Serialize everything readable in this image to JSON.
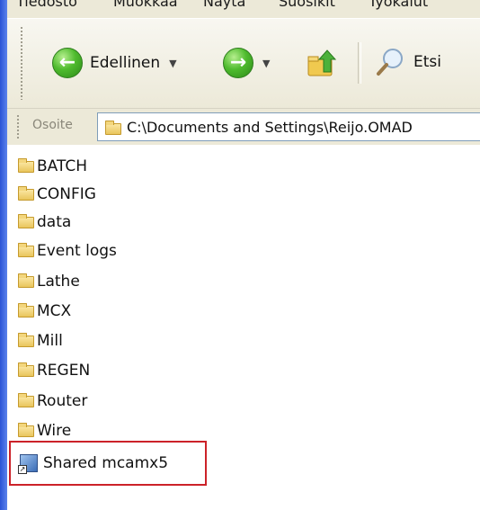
{
  "menu": {
    "items": [
      "Tiedosto",
      "Muokkaa",
      "Näytä",
      "Suosikit",
      "Työkalut"
    ]
  },
  "toolbar": {
    "back_label": "Edellinen",
    "search_label": "Etsi"
  },
  "address": {
    "label": "Osoite",
    "path": "C:\\Documents and Settings\\Reijo.OMAD"
  },
  "folders": [
    "BATCH",
    "CONFIG",
    "data",
    "Event logs",
    "Lathe",
    "MCX",
    "Mill",
    "REGEN",
    "Router",
    "Wire"
  ],
  "shortcut": {
    "label": "Shared mcamx5"
  },
  "colors": {
    "highlight": "#cc2229",
    "xp_blue": "#2a53d6"
  }
}
